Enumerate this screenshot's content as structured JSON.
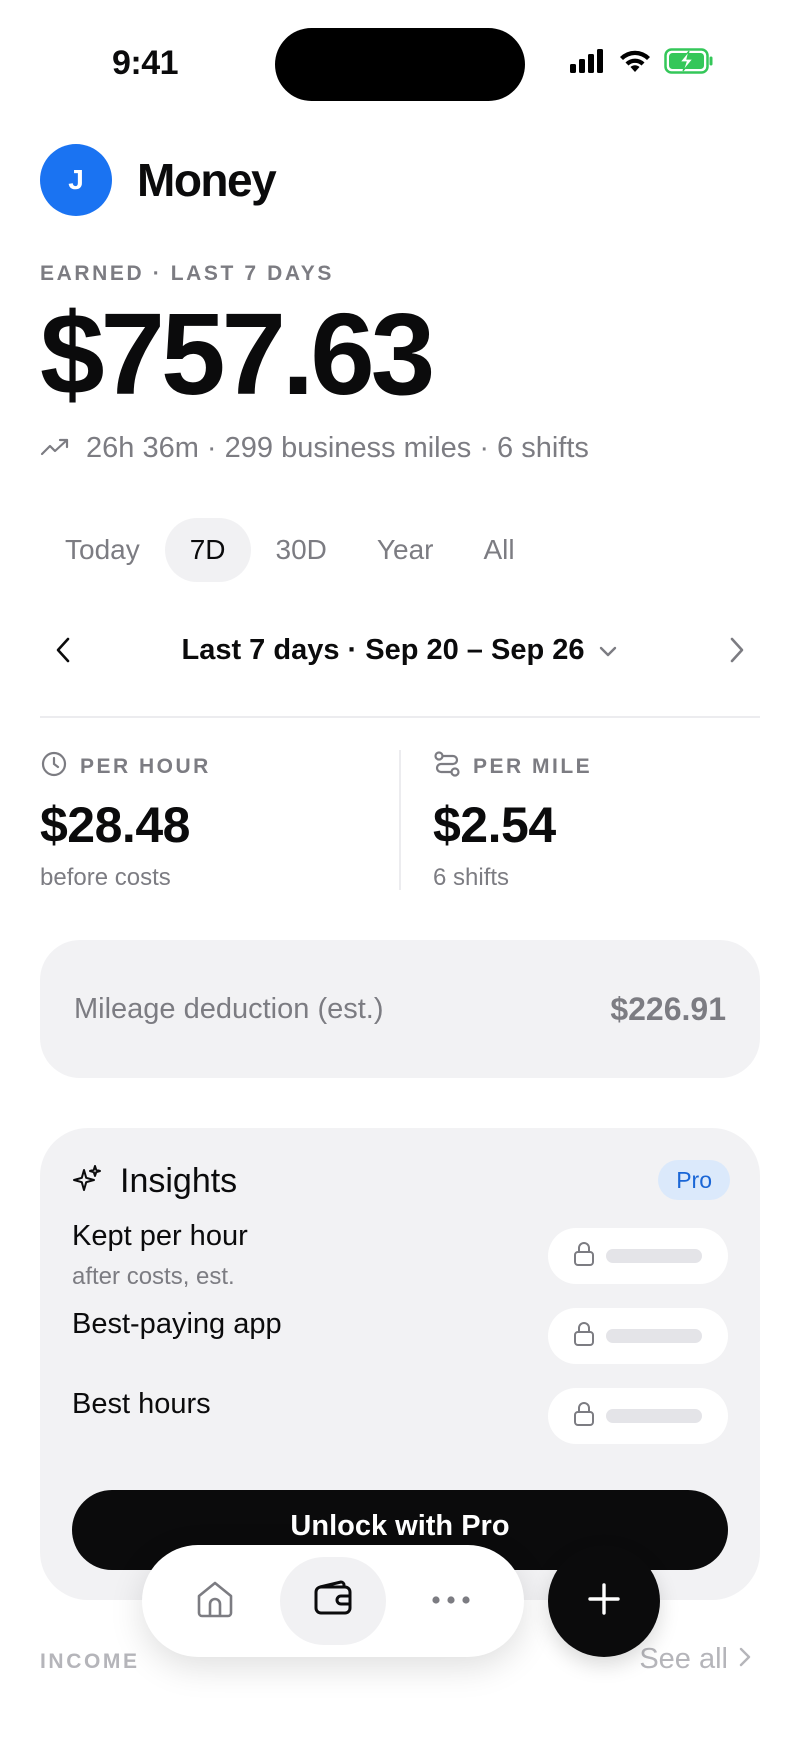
{
  "status_bar": {
    "time": "9:41",
    "icons": [
      "signal-icon",
      "wifi-icon",
      "battery-charging-icon"
    ],
    "battery_color": "#34c759"
  },
  "header": {
    "avatar_initial": "J",
    "avatar_color": "#1a73f2",
    "title": "Money"
  },
  "earnings": {
    "label": "EARNED · LAST 7 DAYS",
    "amount": "$757.63",
    "summary": "26h 36m · 299 business miles · 6 shifts",
    "summary_icon": "trending-up-icon"
  },
  "range_tabs": {
    "items": [
      {
        "label": "Today",
        "active": false
      },
      {
        "label": "7D",
        "active": true
      },
      {
        "label": "30D",
        "active": false
      },
      {
        "label": "Year",
        "active": false
      },
      {
        "label": "All",
        "active": false
      }
    ]
  },
  "period": {
    "label": "Last 7 days · Sep 20 – Sep 26",
    "prev_icon": "chevron-left-icon",
    "next_icon": "chevron-right-icon",
    "dropdown_icon": "chevron-down-icon"
  },
  "metrics": {
    "per_hour": {
      "label": "PER HOUR",
      "value": "$28.48",
      "sub": "before costs",
      "icon": "clock-icon"
    },
    "per_mile": {
      "label": "PER MILE",
      "value": "$2.54",
      "sub": "6 shifts",
      "icon": "route-icon"
    }
  },
  "mileage": {
    "label": "Mileage deduction (est.)",
    "value": "$226.91"
  },
  "insights": {
    "title": "Insights",
    "icon": "sparkles-icon",
    "badge": "Pro",
    "badge_color": "#1a66d6",
    "rows": [
      {
        "label": "Kept per hour",
        "sub": "after costs, est."
      },
      {
        "label": "Best-paying app",
        "sub": ""
      },
      {
        "label": "Best hours",
        "sub": ""
      }
    ],
    "unlock_label": "Unlock with Pro"
  },
  "tab_bar": {
    "items": [
      {
        "icon": "home-icon",
        "active": false
      },
      {
        "icon": "wallet-icon",
        "active": true
      },
      {
        "icon": "more-icon",
        "active": false
      }
    ],
    "fab_icon": "plus-icon"
  },
  "income": {
    "label": "INCOME",
    "see_all": "See all"
  }
}
